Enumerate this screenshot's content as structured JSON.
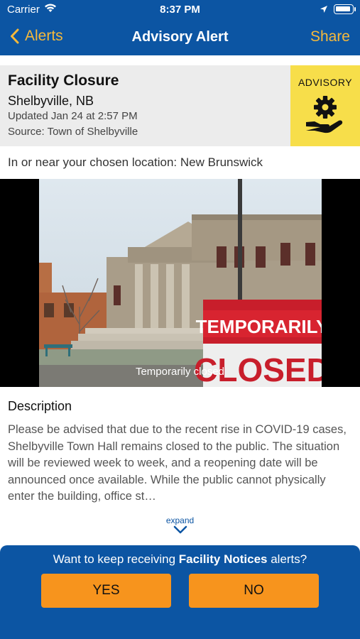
{
  "status_bar": {
    "carrier": "Carrier",
    "time": "8:37 PM"
  },
  "nav": {
    "back_label": "Alerts",
    "title": "Advisory Alert",
    "share_label": "Share"
  },
  "alert": {
    "title": "Facility Closure",
    "location": "Shelbyville, NB",
    "updated": "Updated Jan 24 at 2:57 PM",
    "source": "Source: Town of Shelbyville",
    "badge_label": "ADVISORY",
    "badge_color": "#f7de4a",
    "badge_icon": "gear-in-hand-icon"
  },
  "chosen_location": "In or near your chosen location: New Brunswick",
  "photo": {
    "caption": "Temporarily closed",
    "sign_line1": "TEMPORARILY",
    "sign_line2": "CLOSED"
  },
  "description": {
    "heading": "Description",
    "text": "Please be advised that due to the recent rise in COVID-19 cases, Shelbyville Town Hall remains closed to the public. The situation will be reviewed week to week, and a reopening date will be announced once available. While the public cannot physically enter the building, office st…"
  },
  "expand_label": "expand",
  "prompt": {
    "text_before": "Want to keep receiving ",
    "text_bold": "Facility Notices",
    "text_after": " alerts?",
    "yes_label": "YES",
    "no_label": "NO"
  },
  "colors": {
    "primary": "#0c55a3",
    "accent": "#f6b93b",
    "button": "#f7941d"
  }
}
